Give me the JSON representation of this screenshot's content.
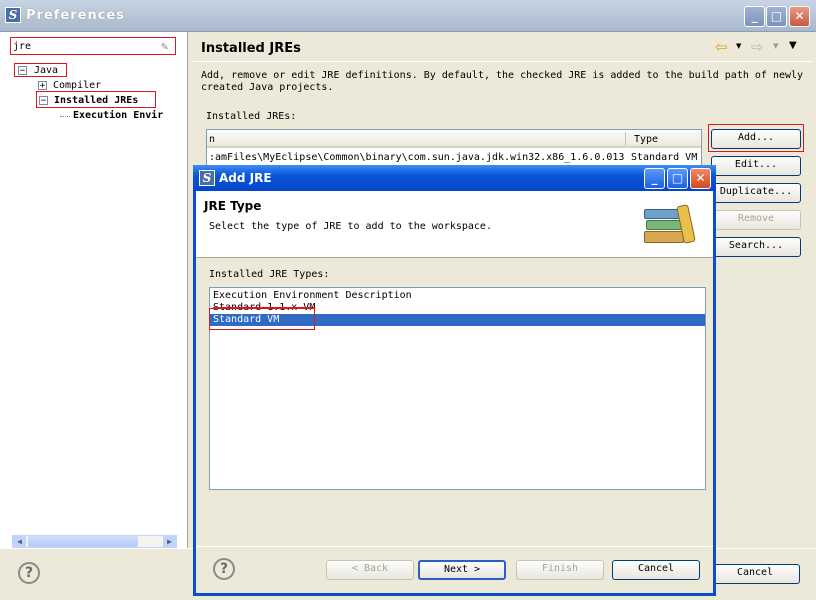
{
  "prefs": {
    "title": "Preferences",
    "filter_value": "jre",
    "tree": [
      {
        "label": "Java",
        "toggle": "−"
      },
      {
        "label": "Compiler",
        "toggle": "+"
      },
      {
        "label": "Installed JREs",
        "toggle": "−"
      },
      {
        "label": "Execution Envir",
        "toggle": ""
      }
    ],
    "page_title": "Installed JREs",
    "description": "Add, remove or edit JRE definitions. By default, the checked JRE is added to the build path of newly created Java projects.",
    "section_label": "Installed JREs:",
    "table_headers": [
      "n",
      "Type"
    ],
    "table_rows": [
      {
        "location": ":amFiles\\MyEclipse\\Common\\binary\\com.sun.java.jdk.win32.x86_1.6.0.013",
        "type": "Standard VM"
      }
    ],
    "buttons": {
      "add": "Add...",
      "edit": "Edit...",
      "duplicate": "Duplicate...",
      "remove": "Remove",
      "search": "Search...",
      "cancel": "Cancel"
    },
    "window_controls": {
      "minimize": "_",
      "maximize": "□",
      "close": "✕"
    },
    "help": "?"
  },
  "dialog": {
    "title": "Add JRE",
    "header_title": "JRE Type",
    "header_desc": "Select the type of JRE to add to the workspace.",
    "list_label": "Installed JRE Types:",
    "list_items": [
      "Execution Environment Description",
      "Standard 1.1.x VM",
      "Standard VM"
    ],
    "selected_index": 2,
    "buttons": {
      "back": "< Back",
      "next": "Next >",
      "finish": "Finish",
      "cancel": "Cancel"
    },
    "help": "?"
  },
  "colors": {
    "selection": "#316AC5",
    "highlight_box": "#E0141E",
    "dialog_title": "#0A56D8"
  }
}
